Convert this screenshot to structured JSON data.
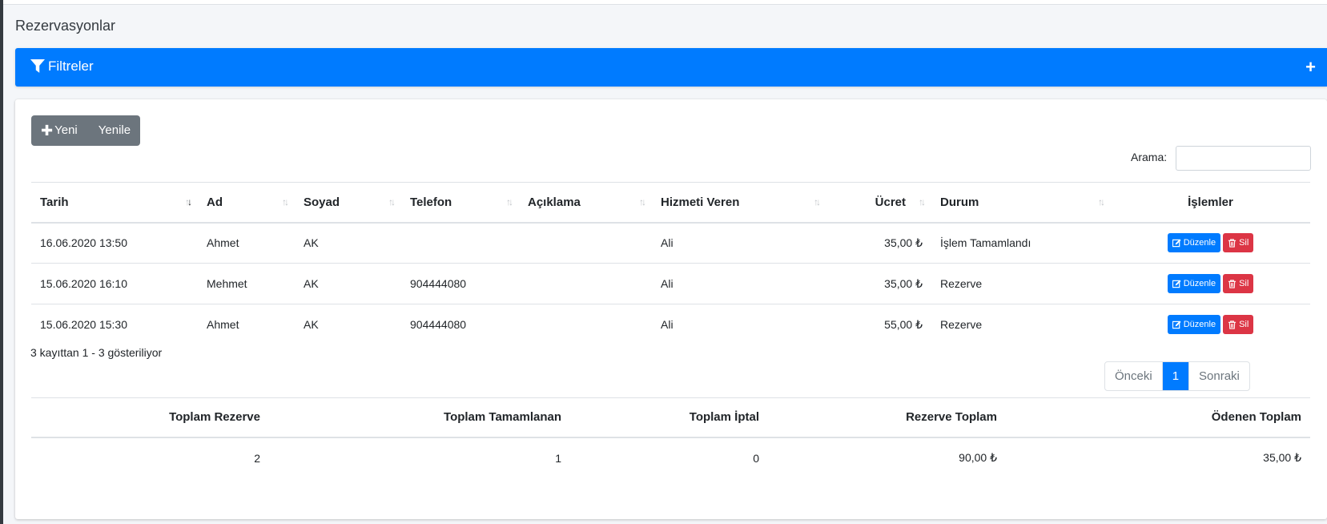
{
  "page": {
    "title": "Rezervasyonlar"
  },
  "filter": {
    "title": "Filtreler",
    "toggle": "+"
  },
  "toolbar": {
    "new_label": "Yeni",
    "refresh_label": "Yenile"
  },
  "search": {
    "label": "Arama:",
    "value": ""
  },
  "table": {
    "columns": [
      "Tarih",
      "Ad",
      "Soyad",
      "Telefon",
      "Açıklama",
      "Hizmeti Veren",
      "Ücret",
      "Durum",
      "İşlemler"
    ],
    "rows": [
      {
        "tarih": "16.06.2020 13:50",
        "ad": "Ahmet",
        "soyad": "AK",
        "telefon": "",
        "aciklama": "",
        "hizmeti_veren": "Ali",
        "ucret": "35,00 ₺",
        "durum": "İşlem Tamamlandı"
      },
      {
        "tarih": "15.06.2020 16:10",
        "ad": "Mehmet",
        "soyad": "AK",
        "telefon": "904444080",
        "aciklama": "",
        "hizmeti_veren": "Ali",
        "ucret": "35,00 ₺",
        "durum": "Rezerve"
      },
      {
        "tarih": "15.06.2020 15:30",
        "ad": "Ahmet",
        "soyad": "AK",
        "telefon": "904444080",
        "aciklama": "",
        "hizmeti_veren": "Ali",
        "ucret": "55,00 ₺",
        "durum": "Rezerve"
      }
    ],
    "edit_label": "Düzenle",
    "delete_label": "Sil",
    "sorted_column": "Tarih",
    "sort_direction": "descending"
  },
  "info": {
    "text": "3 kayıttan 1 - 3 gösteriliyor"
  },
  "pagination": {
    "prev": "Önceki",
    "current": "1",
    "next": "Sonraki"
  },
  "totals": {
    "headers": [
      "Toplam Rezerve",
      "Toplam Tamamlanan",
      "Toplam İptal",
      "Rezerve Toplam",
      "Ödenen Toplam"
    ],
    "values": [
      "2",
      "1",
      "0",
      "90,00 ₺",
      "35,00 ₺"
    ]
  },
  "colors": {
    "primary": "#007bff",
    "danger": "#dc3545",
    "secondary": "#6c757d"
  }
}
